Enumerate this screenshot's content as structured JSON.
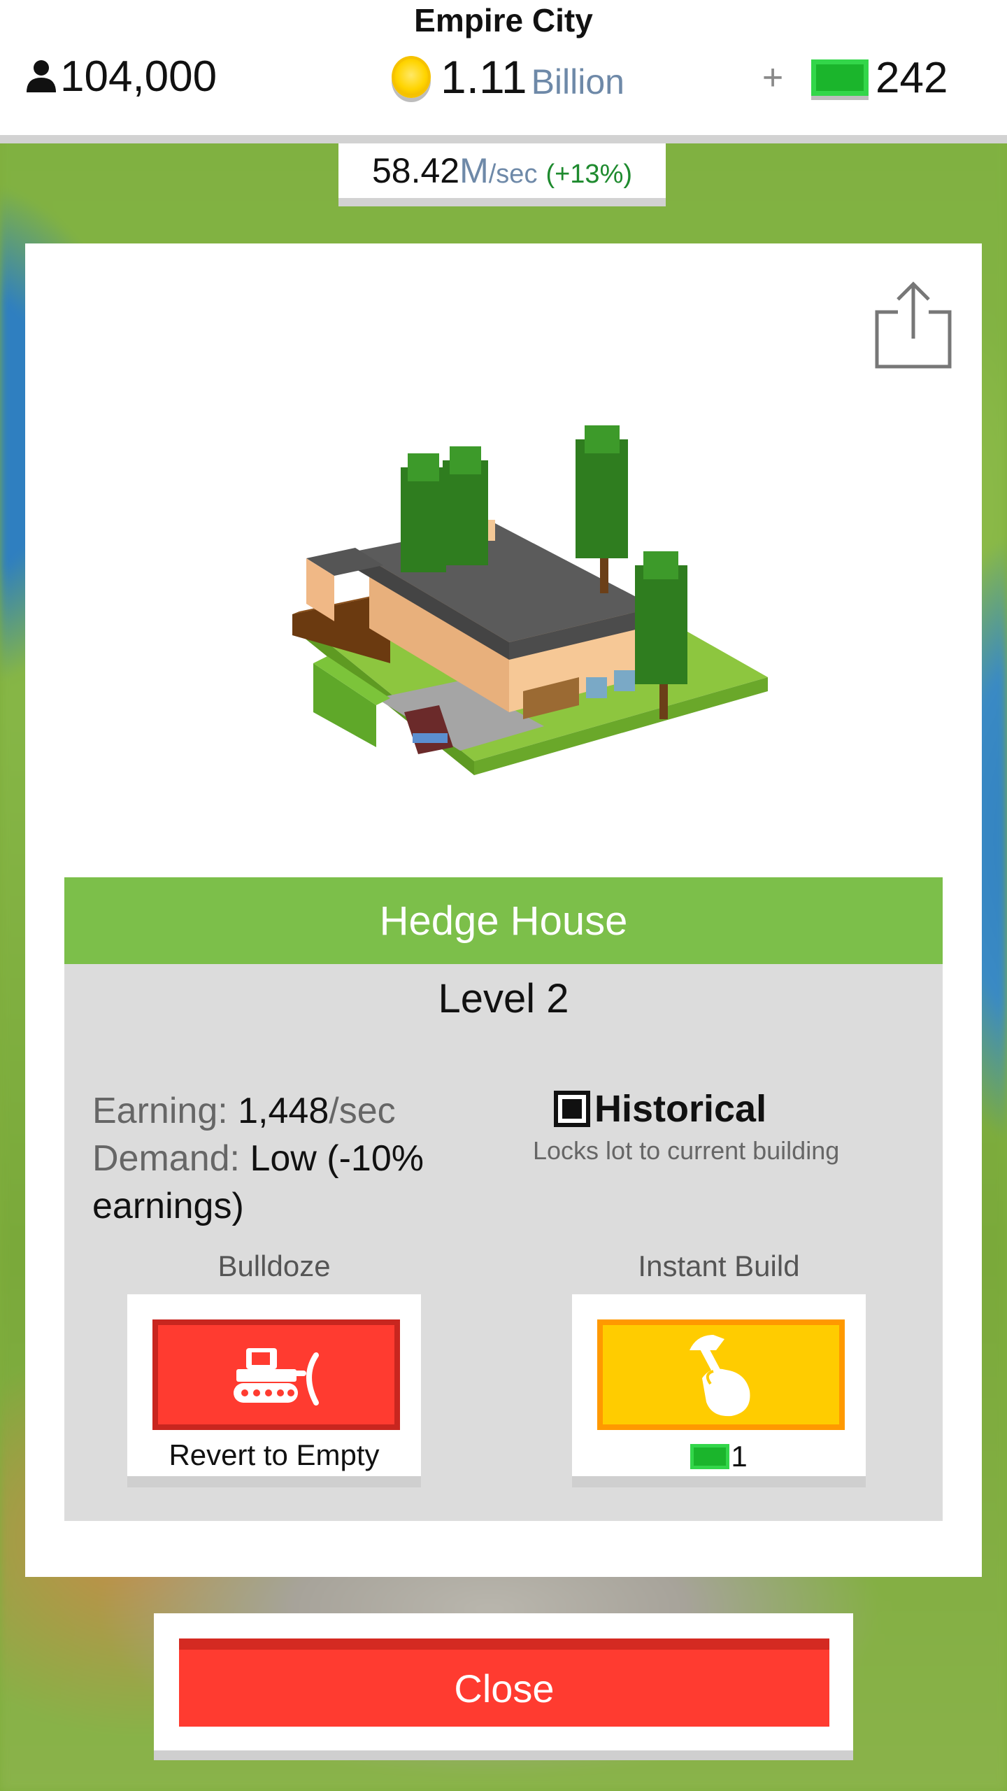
{
  "hud": {
    "city_name": "Empire City",
    "population": "104,000",
    "coins_amount": "1.11",
    "coins_unit": "Billion",
    "plus": "+",
    "cash": "242",
    "rate_value": "58.42",
    "rate_m": "M",
    "rate_per": "/sec",
    "rate_change": "(+13%)"
  },
  "building": {
    "name": "Hedge House",
    "level": "Level 2",
    "earning_label": "Earning:",
    "earning_value": "1,448",
    "earning_unit": "/sec",
    "demand_label": "Demand:",
    "demand_value": "Low (-10% earnings)",
    "historical_label": "Historical",
    "historical_checked": true,
    "historical_desc": "Locks lot to current building"
  },
  "actions": {
    "bulldoze_label": "Bulldoze",
    "bulldoze_caption": "Revert to Empty",
    "instant_build_label": "Instant Build",
    "instant_build_cost": "1"
  },
  "close_label": "Close",
  "icons": {
    "population": "person-icon",
    "coins": "coin-icon",
    "cash": "cash-bill-icon",
    "share": "share-icon",
    "bulldoze": "bulldozer-icon",
    "instant_build": "hammer-hand-icon"
  },
  "colors": {
    "title_bar": "#7cbf4a",
    "bulldoze": "#ff3b30",
    "instant_build": "#ffcc00",
    "close": "#ff3b30",
    "rate_change": "#1e8a2e",
    "unit_text": "#6e89a8"
  }
}
